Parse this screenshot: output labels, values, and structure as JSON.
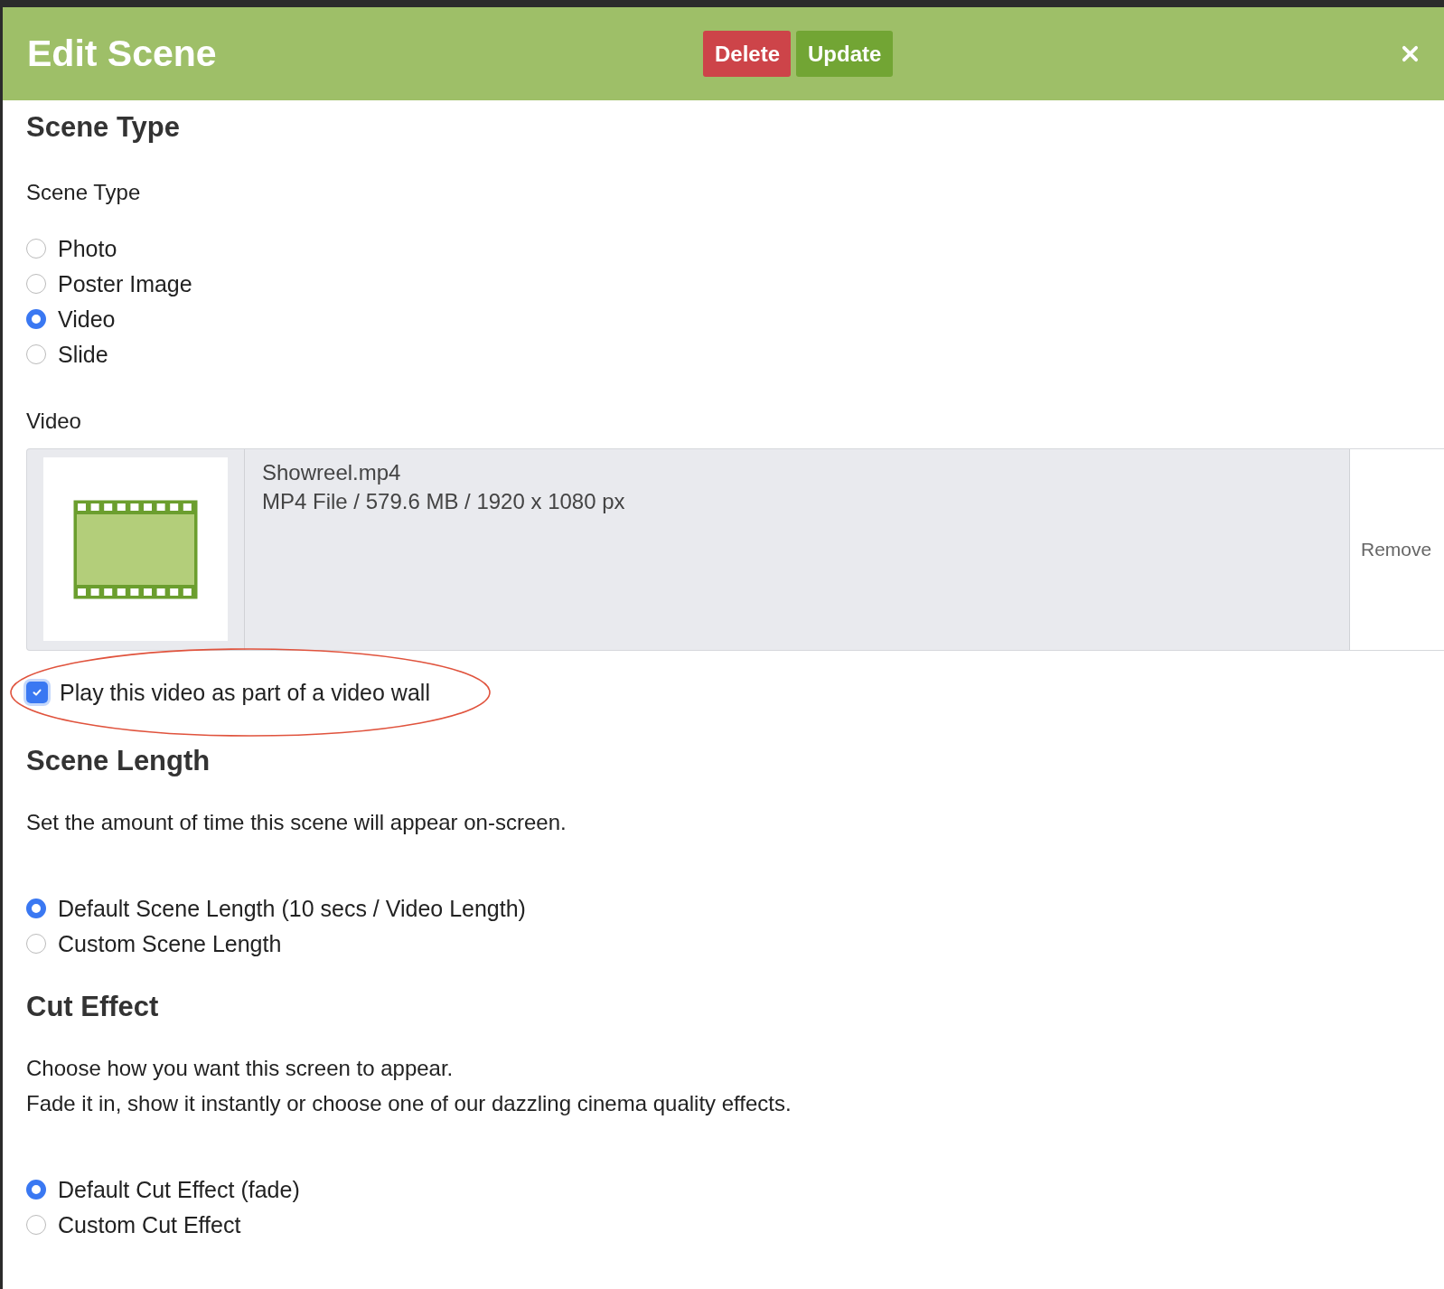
{
  "dialog": {
    "title": "Edit Scene",
    "buttons": [
      {
        "label": "Delete",
        "kind": "danger"
      },
      {
        "label": "Update",
        "kind": "primary"
      }
    ]
  },
  "scene_type": {
    "heading": "Scene Type",
    "field_label": "Scene Type",
    "options": [
      {
        "label": "Photo",
        "selected": false
      },
      {
        "label": "Poster Image",
        "selected": false
      },
      {
        "label": "Video",
        "selected": true
      },
      {
        "label": "Slide",
        "selected": false
      }
    ]
  },
  "video": {
    "label": "Video",
    "file": {
      "name": "Showreel.mp4",
      "details": "MP4 File / 579.6 MB / 1920 x 1080 px",
      "action": "Remove"
    },
    "video_wall": {
      "label": "Play this video as part of a video wall",
      "checked": true,
      "circled": true
    }
  },
  "scene_length": {
    "heading": "Scene Length",
    "description": [
      "Set the amount of time this scene will appear on-screen."
    ],
    "options": [
      {
        "label": "Default Scene Length (10 secs / Video Length)",
        "selected": true
      },
      {
        "label": "Custom Scene Length",
        "selected": false
      }
    ]
  },
  "cut_effect": {
    "heading": "Cut Effect",
    "description": [
      "Choose how you want this screen to appear.",
      "Fade it in, show it instantly or choose one of our dazzling cinema quality effects."
    ],
    "options": [
      {
        "label": "Default Cut Effect (fade)",
        "selected": true
      },
      {
        "label": "Custom Cut Effect",
        "selected": false
      }
    ]
  }
}
